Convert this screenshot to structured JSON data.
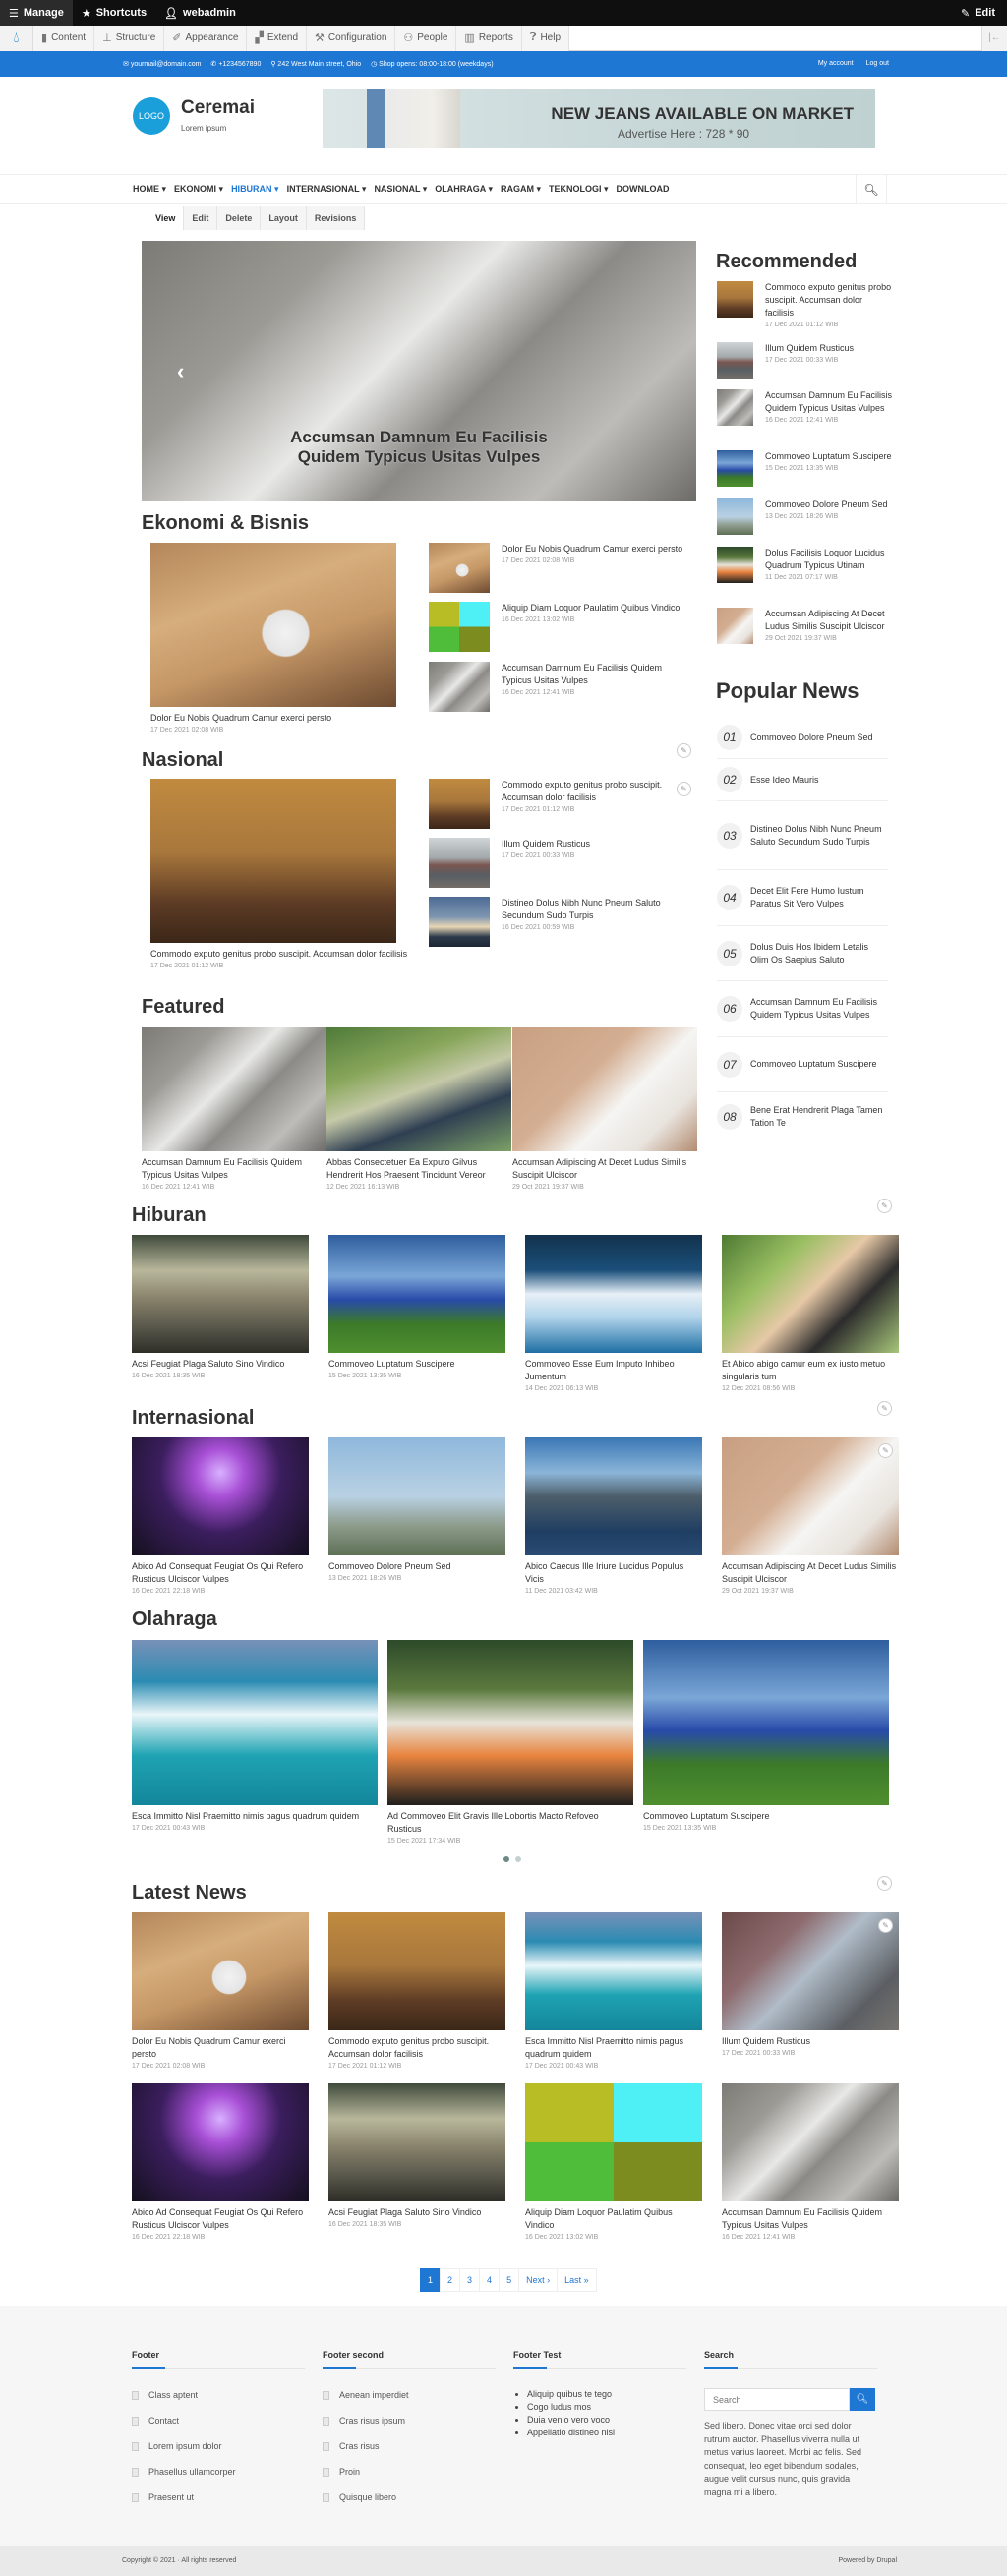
{
  "admin_toolbar": {
    "manage": "Manage",
    "shortcuts": "Shortcuts",
    "user": "webadmin",
    "edit": "Edit",
    "menu": [
      "Content",
      "Structure",
      "Appearance",
      "Extend",
      "Configuration",
      "People",
      "Reports",
      "Help"
    ]
  },
  "topbar": {
    "email": "yourmail@domain.com",
    "phone": "+1234567890",
    "address": "242 West Main street, Ohio",
    "hours": "Shop opens: 08:00-18:00 (weekdays)",
    "my_account": "My account",
    "log_out": "Log out"
  },
  "header": {
    "logo": "LOGO",
    "site_name": "Ceremai",
    "slogan": "Lorem ipsum",
    "ad_title": "NEW JEANS AVAILABLE ON MARKET",
    "ad_subtitle": "Advertise Here : 728 * 90"
  },
  "nav": {
    "items": [
      "HOME ▾",
      "EKONOMI ▾",
      "HIBURAN ▾",
      "INTERNASIONAL ▾",
      "NASIONAL ▾",
      "OLAHRAGA ▾",
      "RAGAM ▾",
      "TEKNOLOGI ▾",
      "DOWNLOAD"
    ],
    "active": "HIBURAN"
  },
  "tabs": [
    "View",
    "Edit",
    "Delete",
    "Layout",
    "Revisions"
  ],
  "slider": {
    "caption": "Accumsan Damnum Eu Facilisis Quidem Typicus Usitas Vulpes"
  },
  "ekonomi": {
    "heading": "Ekonomi & Bisnis",
    "main": {
      "title": "Dolor Eu Nobis Quadrum Camur exerci persto",
      "date": "17 Dec 2021 02:08 WIB"
    },
    "list": [
      {
        "title": "Dolor Eu Nobis Quadrum Camur exerci persto",
        "date": "17 Dec 2021 02:08 WIB"
      },
      {
        "title": "Aliquip Diam Loquor Paulatim Quibus Vindico",
        "date": "16 Dec 2021 13:02 WIB"
      },
      {
        "title": "Accumsan Damnum Eu Facilisis Quidem Typicus Usitas Vulpes",
        "date": "16 Dec 2021 12:41 WIB"
      }
    ]
  },
  "nasional": {
    "heading": "Nasional",
    "main": {
      "title": "Commodo exputo genitus probo suscipit. Accumsan dolor facilisis",
      "date": "17 Dec 2021 01:12 WIB"
    },
    "list": [
      {
        "title": "Commodo exputo genitus probo suscipit. Accumsan dolor facilisis",
        "date": "17 Dec 2021 01:12 WIB"
      },
      {
        "title": "Illum Quidem Rusticus",
        "date": "17 Dec 2021 00:33 WIB"
      },
      {
        "title": "Distineo Dolus Nibh Nunc Pneum Saluto Secundum Sudo Turpis",
        "date": "16 Dec 2021 00:59 WIB"
      }
    ]
  },
  "featured": {
    "heading": "Featured",
    "items": [
      {
        "title": "Accumsan Damnum Eu Facilisis Quidem Typicus Usitas Vulpes",
        "date": "16 Dec 2021 12:41 WIB"
      },
      {
        "title": "Abbas Consectetuer Ea Exputo Gilvus Hendrerit Hos Praesent Tincidunt Vereor",
        "date": "12 Dec 2021 16:13 WIB"
      },
      {
        "title": "Accumsan Adipiscing At Decet Ludus Similis Suscipit Ulciscor",
        "date": "29 Oct 2021 19:37 WIB"
      }
    ]
  },
  "recommended": {
    "heading": "Recommended",
    "items": [
      {
        "title": "Commodo exputo genitus probo suscipit. Accumsan dolor facilisis",
        "date": "17 Dec 2021 01:12 WIB"
      },
      {
        "title": "Illum Quidem Rusticus",
        "date": "17 Dec 2021 00:33 WIB"
      },
      {
        "title": "Accumsan Damnum Eu Facilisis Quidem Typicus Usitas Vulpes",
        "date": "16 Dec 2021 12:41 WIB"
      },
      {
        "title": "Commoveo Luptatum Suscipere",
        "date": "15 Dec 2021 13:35 WIB"
      },
      {
        "title": "Commoveo Dolore Pneum Sed",
        "date": "13 Dec 2021 18:26 WIB"
      },
      {
        "title": "Dolus Facilisis Loquor Lucidus Quadrum Typicus Utinam",
        "date": "11 Dec 2021 07:17 WIB"
      },
      {
        "title": "Accumsan Adipiscing At Decet Ludus Similis Suscipit Ulciscor",
        "date": "29 Oct 2021 19:37 WIB"
      }
    ]
  },
  "popular": {
    "heading": "Popular News",
    "items": [
      {
        "num": "01",
        "title": "Commoveo Dolore Pneum Sed"
      },
      {
        "num": "02",
        "title": "Esse Ideo Mauris"
      },
      {
        "num": "03",
        "title": "Distineo Dolus Nibh Nunc Pneum Saluto Secundum Sudo Turpis"
      },
      {
        "num": "04",
        "title": "Decet Elit Fere Humo Iustum Paratus Sit Vero Vulpes"
      },
      {
        "num": "05",
        "title": "Dolus Duis Hos Ibidem Letalis Olim Os Saepius Saluto"
      },
      {
        "num": "06",
        "title": "Accumsan Damnum Eu Facilisis Quidem Typicus Usitas Vulpes"
      },
      {
        "num": "07",
        "title": "Commoveo Luptatum Suscipere"
      },
      {
        "num": "08",
        "title": "Bene Erat Hendrerit Plaga Tamen Tation Te"
      }
    ]
  },
  "hiburan": {
    "heading": "Hiburan",
    "items": [
      {
        "title": "Acsi Feugiat Plaga Saluto Sino Vindico",
        "date": "16 Dec 2021 18:35 WIB"
      },
      {
        "title": "Commoveo Luptatum Suscipere",
        "date": "15 Dec 2021 13:35 WIB"
      },
      {
        "title": "Commoveo Esse Eum Imputo Inhibeo Jumentum",
        "date": "14 Dec 2021 06:13 WIB"
      },
      {
        "title": "Et Abico abigo camur eum ex iusto metuo singularis tum",
        "date": "12 Dec 2021 08:56 WIB"
      }
    ]
  },
  "internasional": {
    "heading": "Internasional",
    "items": [
      {
        "title": "Abico Ad Consequat Feugiat Os Qui Refero Rusticus Ulciscor Vulpes",
        "date": "16 Dec 2021 22:18 WIB"
      },
      {
        "title": "Commoveo Dolore Pneum Sed",
        "date": "13 Dec 2021 18:26 WIB"
      },
      {
        "title": "Abico Caecus Ille Iriure Lucidus Populus Vicis",
        "date": "11 Dec 2021 03:42 WIB"
      },
      {
        "title": "Accumsan Adipiscing At Decet Ludus Similis Suscipit Ulciscor",
        "date": "29 Oct 2021 19:37 WIB"
      }
    ]
  },
  "olahraga": {
    "heading": "Olahraga",
    "items": [
      {
        "title": "Esca Immitto Nisl Praemitto nimis pagus quadrum quidem",
        "date": "17 Dec 2021 00:43 WIB"
      },
      {
        "title": "Ad Commoveo Elit Gravis Ille Lobortis Macto Refoveo Rusticus",
        "date": "15 Dec 2021 17:34 WIB"
      },
      {
        "title": "Commoveo Luptatum Suscipere",
        "date": "15 Dec 2021 13:35 WIB"
      }
    ],
    "carousel_pages": 2,
    "carousel_active": 1
  },
  "latest": {
    "heading": "Latest News",
    "items": [
      {
        "title": "Dolor Eu Nobis Quadrum Camur exerci persto",
        "date": "17 Dec 2021 02:08 WIB"
      },
      {
        "title": "Commodo exputo genitus probo suscipit. Accumsan dolor facilisis",
        "date": "17 Dec 2021 01:12 WIB"
      },
      {
        "title": "Esca Immitto Nisl Praemitto nimis pagus quadrum quidem",
        "date": "17 Dec 2021 00:43 WIB"
      },
      {
        "title": "Illum Quidem Rusticus",
        "date": "17 Dec 2021 00:33 WIB"
      },
      {
        "title": "Abico Ad Consequat Feugiat Os Qui Refero Rusticus Ulciscor Vulpes",
        "date": "16 Dec 2021 22:18 WIB"
      },
      {
        "title": "Acsi Feugiat Plaga Saluto Sino Vindico",
        "date": "16 Dec 2021 18:35 WIB"
      },
      {
        "title": "Aliquip Diam Loquor Paulatim Quibus Vindico",
        "date": "16 Dec 2021 13:02 WIB"
      },
      {
        "title": "Accumsan Damnum Eu Facilisis Quidem Typicus Usitas Vulpes",
        "date": "16 Dec 2021 12:41 WIB"
      }
    ]
  },
  "pager": {
    "pages": [
      "1",
      "2",
      "3",
      "4",
      "5"
    ],
    "current": "1",
    "next": "Next ›",
    "last": "Last »"
  },
  "footer": {
    "col1": {
      "heading": "Footer",
      "items": [
        "Class aptent",
        "Contact",
        "Lorem ipsum dolor",
        "Phasellus ullamcorper",
        "Praesent ut"
      ]
    },
    "col2": {
      "heading": "Footer second",
      "items": [
        "Aenean imperdiet",
        "Cras risus ipsum",
        "Cras risus",
        "Proin",
        "Quisque libero"
      ]
    },
    "col3": {
      "heading": "Footer Test",
      "items": [
        "Aliquip quibus te tego",
        "Cogo ludus mos",
        "Duia venio vero voco",
        "Appellatio distineo nisl"
      ]
    },
    "col4": {
      "heading": "Search",
      "placeholder": "Search",
      "text": "Sed libero. Donec vitae orci sed dolor rutrum auctor. Phasellus viverra nulla ut metus varius laoreet. Morbi ac felis. Sed consequat, leo eget bibendum sodales, augue velit cursus nunc, quis gravida magna mi a libero."
    },
    "copyright": "Copyright © 2021 · All rights reserved",
    "powered": "Powered by Drupal"
  },
  "colors": {
    "accent": "#1f77d4",
    "toolbar": "#0f0f0f",
    "logo": "#1a9fdb"
  }
}
